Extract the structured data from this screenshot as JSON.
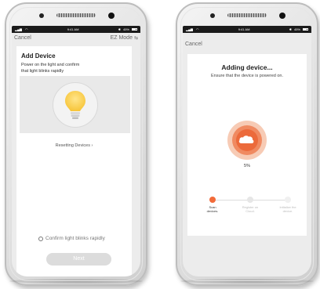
{
  "status_bar": {
    "time": "9:41 AM",
    "battery": "45%"
  },
  "left_screen": {
    "nav": {
      "cancel": "Cancel",
      "mode": "EZ Mode",
      "mode_icon": "swap-arrows-icon"
    },
    "title": "Add Device",
    "desc_line1": "Power on the light and confirm",
    "desc_line2": "that light blinks  rapidly",
    "reset_link": "Resetting Devices ›",
    "confirm_label": "Confirm light blinks rapidly",
    "next_button": "Next"
  },
  "right_screen": {
    "nav": {
      "cancel": "Cancel"
    },
    "title": "Adding device...",
    "subtitle": "Ensure that the device is powered on.",
    "progress_percent": "5%",
    "progress_value": 0.05,
    "steps": [
      {
        "label_line1": "Scan",
        "label_line2": "devices."
      },
      {
        "label_line1": "Register on",
        "label_line2": "Cloud."
      },
      {
        "label_line1": "Initialize the",
        "label_line2": "device."
      }
    ],
    "accent_color": "#f26b3a"
  }
}
